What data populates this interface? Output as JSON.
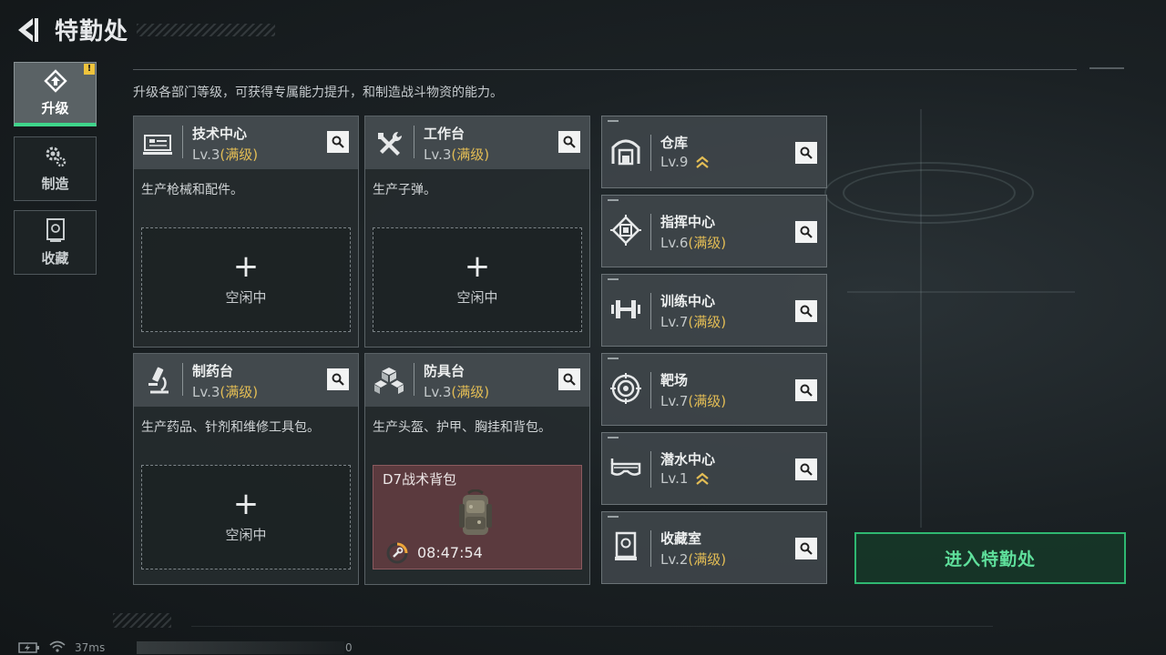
{
  "header": {
    "title": "特勤处"
  },
  "nav": [
    {
      "label": "升级",
      "icon": "upgrade-icon",
      "active": true,
      "alert": "!"
    },
    {
      "label": "制造",
      "icon": "gears-icon",
      "active": false
    },
    {
      "label": "收藏",
      "icon": "collection-icon",
      "active": false
    }
  ],
  "description": "升级各部门等级，可获得专属能力提升，和制造战斗物资的能力。",
  "big_cards": [
    {
      "name": "技术中心",
      "level": "Lv.3",
      "status": "(满级)",
      "icon": "tech-center-icon",
      "text": "生产枪械和配件。",
      "slot": {
        "plus": "+",
        "label": "空闲中"
      }
    },
    {
      "name": "工作台",
      "level": "Lv.3",
      "status": "(满级)",
      "icon": "workbench-tools-icon",
      "text": "生产子弹。",
      "slot": {
        "plus": "+",
        "label": "空闲中"
      }
    },
    {
      "name": "制药台",
      "level": "Lv.3",
      "status": "(满级)",
      "icon": "microscope-icon",
      "text": "生产药品、针剂和维修工具包。",
      "slot": {
        "plus": "+",
        "label": "空闲中"
      }
    },
    {
      "name": "防具台",
      "level": "Lv.3",
      "status": "(满级)",
      "icon": "armor-cubes-icon",
      "text": "生产头盔、护甲、胸挂和背包。",
      "crafting": {
        "item": "D7战术背包",
        "time": "08:47:54",
        "icon": "backpack-icon"
      }
    }
  ],
  "small_cards": [
    {
      "name": "仓库",
      "level": "Lv.9",
      "status": "",
      "upgradable": true,
      "icon": "warehouse-icon"
    },
    {
      "name": "指挥中心",
      "level": "Lv.6",
      "status": "(满级)",
      "upgradable": false,
      "icon": "chip-icon"
    },
    {
      "name": "训练中心",
      "level": "Lv.7",
      "status": "(满级)",
      "upgradable": false,
      "icon": "dumbbell-icon"
    },
    {
      "name": "靶场",
      "level": "Lv.7",
      "status": "(满级)",
      "upgradable": false,
      "icon": "target-icon"
    },
    {
      "name": "潜水中心",
      "level": "Lv.1",
      "status": "",
      "upgradable": true,
      "icon": "diving-mask-icon"
    },
    {
      "name": "收藏室",
      "level": "Lv.2",
      "status": "(满级)",
      "upgradable": false,
      "icon": "display-case-icon"
    }
  ],
  "enter_button": "进入特勤处",
  "status_bar": {
    "ping": "37ms",
    "counter": "0"
  },
  "colors": {
    "accent_green": "#3fd58b",
    "maxed_gold": "#e3bd55",
    "alert_yellow": "#f0c43c"
  }
}
